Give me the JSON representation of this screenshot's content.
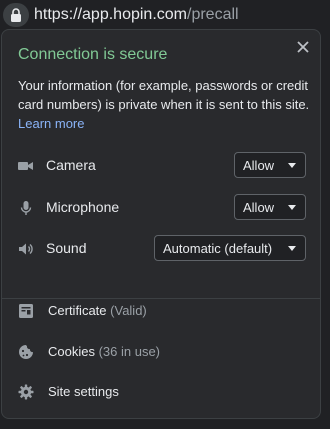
{
  "address_bar": {
    "scheme": "https://",
    "host": "app.hopin.com",
    "path": "/precall"
  },
  "popup": {
    "title": "Connection is secure",
    "description": "Your information (for example, passwords or credit card numbers) is private when it is sent to this site.",
    "learn_more": "Learn more",
    "permissions": [
      {
        "label": "Camera",
        "value": "Allow",
        "icon": "camera-icon"
      },
      {
        "label": "Microphone",
        "value": "Allow",
        "icon": "microphone-icon"
      },
      {
        "label": "Sound",
        "value": "Automatic (default)",
        "icon": "sound-icon"
      }
    ],
    "links": [
      {
        "label": "Certificate",
        "detail": "(Valid)",
        "icon": "certificate-icon"
      },
      {
        "label": "Cookies",
        "detail": "(36 in use)",
        "icon": "cookie-icon"
      },
      {
        "label": "Site settings",
        "detail": "",
        "icon": "gear-icon"
      }
    ]
  },
  "colors": {
    "secure_green": "#81c995",
    "link_blue": "#8ab4f8",
    "panel_bg": "#292a2d"
  }
}
